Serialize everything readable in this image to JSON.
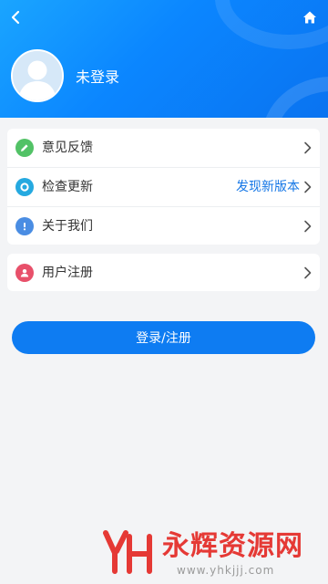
{
  "header": {
    "back_icon": "chevron-left-icon",
    "home_icon": "home-icon",
    "avatar_icon": "default-avatar-icon",
    "login_status": "未登录"
  },
  "menu_group_1": [
    {
      "label": "意见反馈",
      "icon": "pencil-icon",
      "icon_color": "#52c266"
    },
    {
      "label": "检查更新",
      "icon": "refresh-icon",
      "icon_color": "#25a9e0",
      "value": "发现新版本"
    },
    {
      "label": "关于我们",
      "icon": "info-icon",
      "icon_color": "#4a8de3"
    }
  ],
  "menu_group_2": [
    {
      "label": "用户注册",
      "icon": "user-icon",
      "icon_color": "#e8506a"
    }
  ],
  "login_button": {
    "label": "登录/注册"
  },
  "watermark": {
    "name": "永辉资源网",
    "url": "www.yhkjjj.com"
  },
  "colors": {
    "header_blue": "#0b86ff",
    "accent_blue": "#1677e6",
    "button_blue": "#0e7cf2",
    "watermark_red": "#e53935"
  }
}
